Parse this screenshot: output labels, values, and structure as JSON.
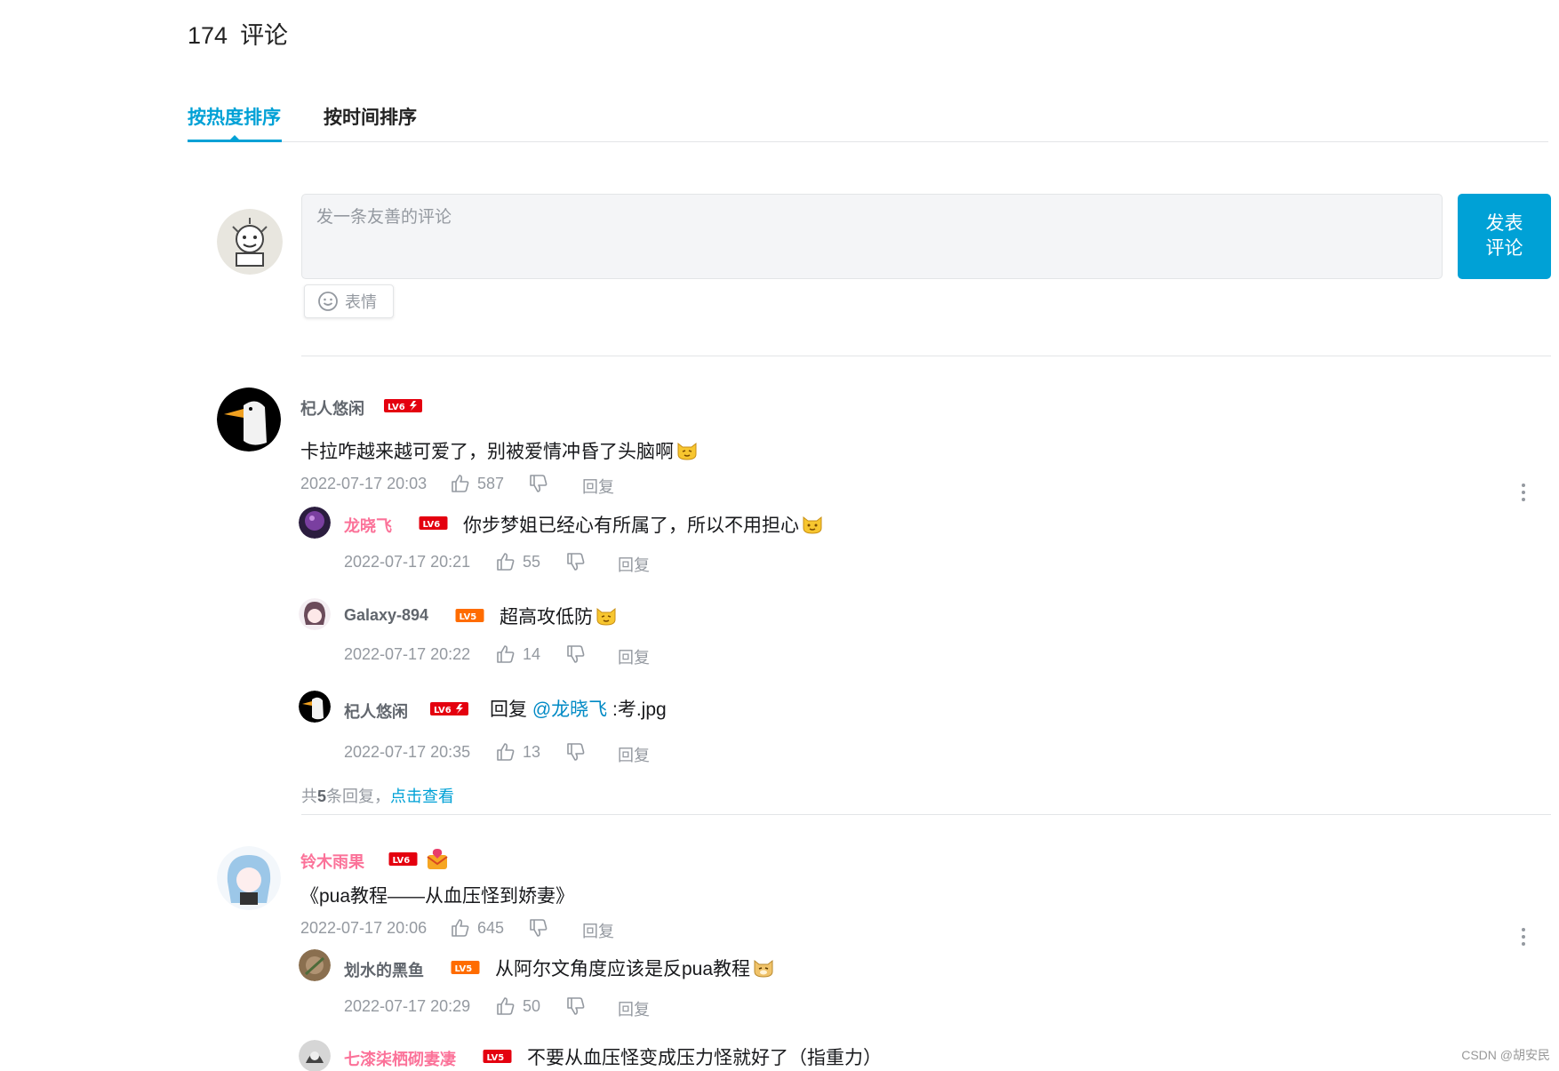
{
  "header": {
    "count": "174",
    "title": "评论"
  },
  "tabs": [
    {
      "label": "按热度排序",
      "active": true
    },
    {
      "label": "按时间排序",
      "active": false
    }
  ],
  "composer": {
    "placeholder": "发一条友善的评论",
    "emoji_label": "表情",
    "send_line1": "发表",
    "send_line2": "评论"
  },
  "comments": [
    {
      "user": "杞人悠闲",
      "level": "LV6",
      "text": "卡拉咋越来越可爱了，别被爱情冲昏了头脑啊",
      "time": "2022-07-17 20:03",
      "likes": "587",
      "reply_label": "回复",
      "replies": [
        {
          "user": "龙晓飞",
          "level": "LV6",
          "text": "你步梦姐已经心有所属了，所以不用担心",
          "time": "2022-07-17 20:21",
          "likes": "55",
          "reply_label": "回复"
        },
        {
          "user": "Galaxy-894",
          "level": "LV5",
          "text": "超高攻低防",
          "time": "2022-07-17 20:22",
          "likes": "14",
          "reply_label": "回复"
        },
        {
          "user": "杞人悠闲",
          "level": "LV6",
          "text_prefix": "回复 ",
          "mention": "@龙晓飞",
          "text_suffix": " :考.jpg",
          "time": "2022-07-17 20:35",
          "likes": "13",
          "reply_label": "回复"
        }
      ],
      "summary_prefix": "共",
      "summary_count": "5",
      "summary_suffix": "条回复，",
      "summary_link": "点击查看"
    },
    {
      "user": "铃木雨果",
      "level": "LV6",
      "text": "《pua教程——从血压怪到娇妻》",
      "time": "2022-07-17 20:06",
      "likes": "645",
      "reply_label": "回复",
      "replies": [
        {
          "user": "划水的黑鱼",
          "level": "LV5",
          "text": "从阿尔文角度应该是反pua教程",
          "time": "2022-07-17 20:29",
          "likes": "50",
          "reply_label": "回复"
        },
        {
          "user": "七漆柒栖砌妻凄",
          "level": "LV5",
          "text": "不要从血压怪变成压力怪就好了（指重力）"
        }
      ]
    }
  ],
  "watermark": "CSDN @胡安民",
  "colors": {
    "accent": "#00a1d6",
    "vip_name": "#fb7299",
    "lv6": "#e4000f",
    "lv5": "#ff6c00"
  }
}
